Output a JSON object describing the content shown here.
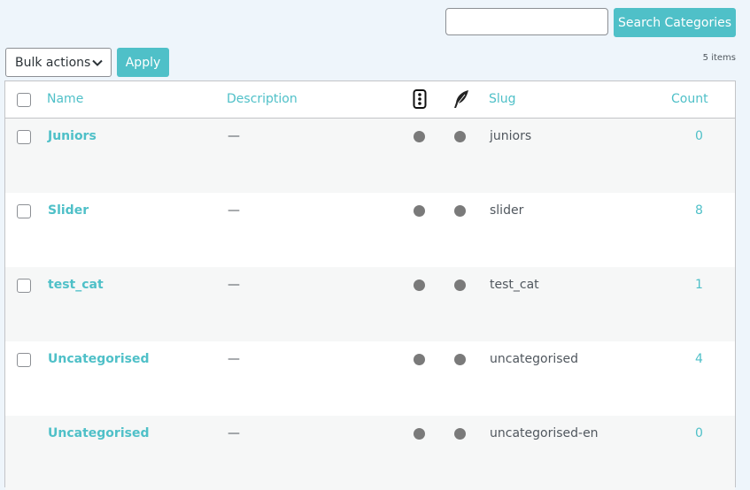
{
  "search": {
    "placeholder": "",
    "value": "",
    "button_label": "Search Categories"
  },
  "bulk": {
    "selected": "Bulk actions",
    "apply_label": "Apply"
  },
  "items_count": "5 items",
  "table": {
    "headers": {
      "name": "Name",
      "description": "Description",
      "icon1": "traffic-light-icon",
      "icon2": "feather-icon",
      "slug": "Slug",
      "count": "Count"
    },
    "rows": [
      {
        "name": "Juniors",
        "description": "—",
        "slug": "juniors",
        "count": "0",
        "checkbox": true
      },
      {
        "name": "Slider",
        "description": "—",
        "slug": "slider",
        "count": "8",
        "checkbox": true
      },
      {
        "name": "test_cat",
        "description": "—",
        "slug": "test_cat",
        "count": "1",
        "checkbox": true
      },
      {
        "name": "Uncategorised",
        "description": "—",
        "slug": "uncategorised",
        "count": "4",
        "checkbox": true
      },
      {
        "name": "Uncategorised",
        "description": "—",
        "slug": "uncategorised-en",
        "count": "0",
        "checkbox": false
      }
    ]
  },
  "colors": {
    "accent": "#4fc0c8",
    "dot": "#7a7a7a",
    "background": "#eef5fb"
  }
}
